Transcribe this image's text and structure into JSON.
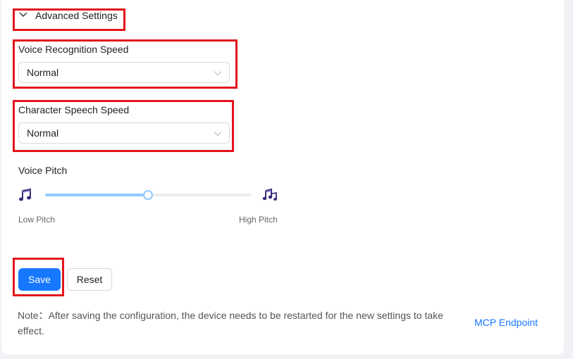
{
  "advanced": {
    "title": "Advanced Settings"
  },
  "voice_recognition": {
    "label": "Voice Recognition Speed",
    "value": "Normal"
  },
  "character_speech": {
    "label": "Character Speech Speed",
    "value": "Normal"
  },
  "voice_pitch": {
    "label": "Voice Pitch",
    "low_label": "Low Pitch",
    "high_label": "High Pitch",
    "value_fraction": 0.5,
    "low_icon": "music-note-icon",
    "high_icon": "music-notes-icon"
  },
  "actions": {
    "save_label": "Save",
    "reset_label": "Reset"
  },
  "note": "Note：After saving the configuration, the device needs to be restarted for the new settings to take effect.",
  "link": {
    "label": "MCP Endpoint"
  },
  "colors": {
    "primary": "#1677ff",
    "slider": "#91caff",
    "highlight": "#e3151c",
    "icon": "#3a2a7a"
  }
}
